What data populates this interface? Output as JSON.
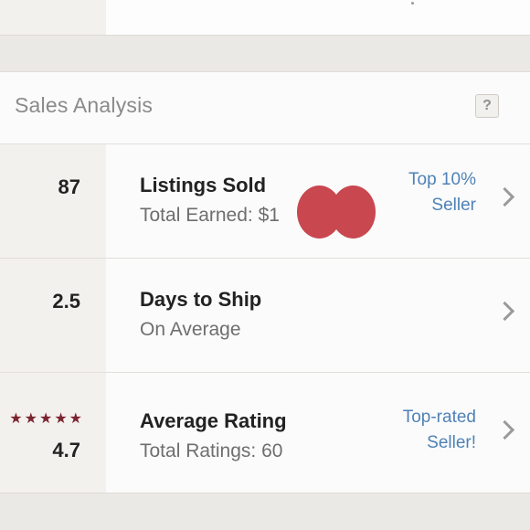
{
  "sales_analysis": {
    "title": "Sales Analysis",
    "help_label": "?",
    "rows": [
      {
        "value": "87",
        "title": "Listings Sold",
        "subtitle": "Total Earned: $1",
        "badge_line1": "Top 10%",
        "badge_line2": "Seller"
      },
      {
        "value": "2.5",
        "title": "Days to Ship",
        "subtitle": "On Average"
      },
      {
        "value": "4.7",
        "stars": "★★★★★",
        "title": "Average Rating",
        "subtitle": "Total Ratings: 60",
        "badge_line1": "Top-rated",
        "badge_line2": "Seller!"
      }
    ]
  },
  "colors": {
    "link_blue": "#4f82b6",
    "star_red": "#7b2530",
    "redaction_red": "#c9474f"
  },
  "icons": {
    "help": "question-mark-icon",
    "row_arrow": "chevron-right-icon",
    "rating": "star-icon"
  }
}
